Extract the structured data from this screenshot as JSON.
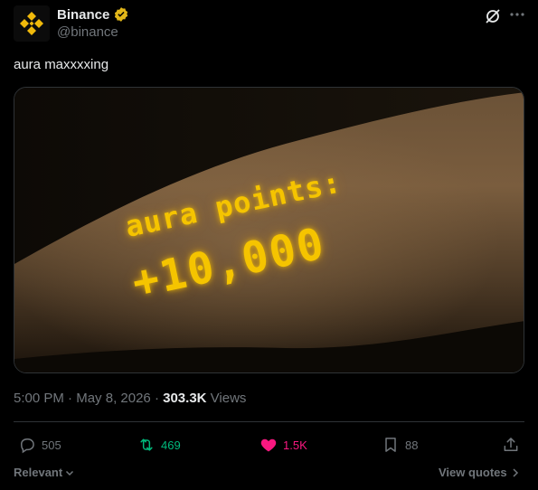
{
  "author": {
    "name": "Binance",
    "handle": "@binance",
    "verified_badge_color": "#e2b719",
    "logo_color": "#f0b90b"
  },
  "tweet": {
    "text": "aura maxxxxing"
  },
  "media": {
    "overlay_line1": "aura points:",
    "overlay_line2": "+10,000",
    "overlay_color": "#f5c400"
  },
  "meta": {
    "time": "5:00 PM",
    "separator1": " · ",
    "date": "May 8, 2026",
    "separator2": " · ",
    "views_count": "303.3K",
    "views_label": " Views"
  },
  "actions": {
    "replies": "505",
    "reposts": "469",
    "likes": "1.5K",
    "bookmarks": "88"
  },
  "footer": {
    "sort_label": "Relevant",
    "view_quotes_label": "View quotes"
  },
  "icons": {
    "grok": "grok-icon",
    "more": "more-icon",
    "reply": "reply-icon",
    "repost": "repost-icon",
    "like": "heart-icon",
    "bookmark": "bookmark-icon",
    "share": "share-icon"
  }
}
